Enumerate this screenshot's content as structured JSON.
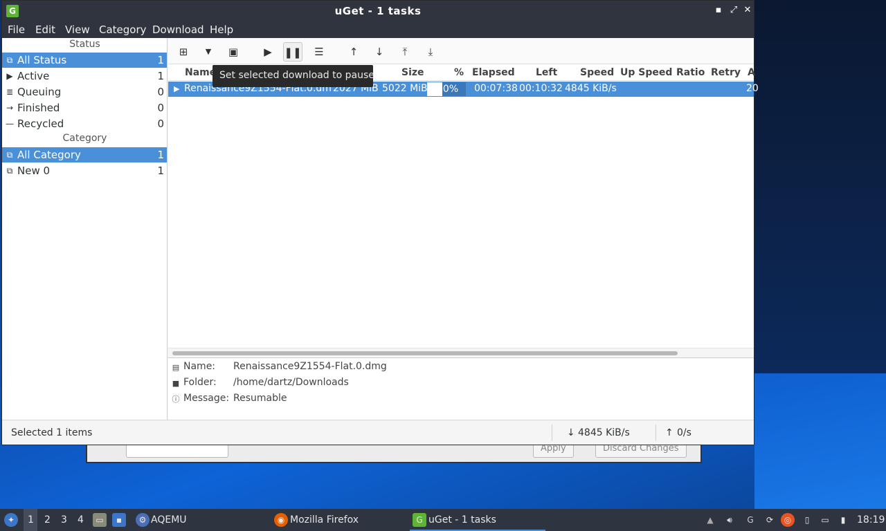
{
  "window": {
    "title": "uGet - 1 tasks",
    "app_icon": "uget-icon"
  },
  "menu": [
    "File",
    "Edit",
    "View",
    "Category",
    "Download",
    "Help"
  ],
  "sidebar": {
    "status_header": "Status",
    "status_items": [
      {
        "label": "All Status",
        "count": "1",
        "icon": "all-status-icon"
      },
      {
        "label": "Active",
        "count": "1",
        "icon": "play-icon"
      },
      {
        "label": "Queuing",
        "count": "0",
        "icon": "queue-icon"
      },
      {
        "label": "Finished",
        "count": "0",
        "icon": "finished-icon"
      },
      {
        "label": "Recycled",
        "count": "0",
        "icon": "recycled-icon"
      }
    ],
    "category_header": "Category",
    "category_items": [
      {
        "label": "All Category",
        "count": "1"
      },
      {
        "label": "New 0",
        "count": "1"
      }
    ]
  },
  "toolbar": {
    "icons": [
      "new-download-icon",
      "dropdown-arrow-icon",
      "save-icon",
      "start-icon",
      "pause-icon",
      "properties-icon",
      "move-up-icon",
      "move-down-icon",
      "move-top-icon",
      "move-bottom-icon"
    ]
  },
  "tooltip": "Set selected download to pause",
  "list": {
    "columns": [
      "Name",
      "Size",
      "%",
      "Elapsed",
      "Left",
      "Speed",
      "Up Speed",
      "Ratio",
      "Retry",
      "A"
    ],
    "rows": [
      {
        "name": "Renaissance9Z1554-Flat.0.dm",
        "complete": "2027 MiB",
        "size": "5022 MiB",
        "percent_label": "40%",
        "percent": 40,
        "elapsed": "00:07:38",
        "left": "00:10:32",
        "speed": "4845 KiB/s",
        "added": "20"
      }
    ]
  },
  "details": {
    "name_key": "Name:",
    "name_value": "Renaissance9Z1554-Flat.0.dmg",
    "folder_key": "Folder:",
    "folder_value": "/home/dartz/Downloads",
    "message_key": "Message:",
    "message_value": "Resumable"
  },
  "statusbar": {
    "selected": "Selected 1 items",
    "down_speed": "4845 KiB/s",
    "up_speed": "0/s"
  },
  "background_dialog": {
    "apply": "Apply",
    "discard": "Discard Changes"
  },
  "taskbar": {
    "workspaces": [
      "1",
      "2",
      "3",
      "4"
    ],
    "tasks": [
      "AQEMU",
      "Mozilla Firefox",
      "uGet - 1 tasks"
    ],
    "clock": "18:19"
  },
  "colors": {
    "selection": "#4a90d9",
    "titlebar": "#2f343f",
    "taskbar": "#2e3440"
  }
}
